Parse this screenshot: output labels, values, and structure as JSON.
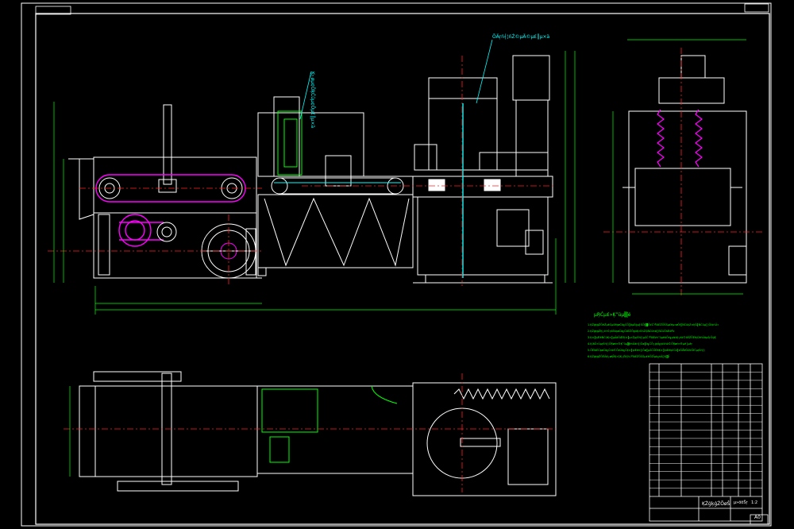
{
  "drawing": {
    "background": "#000000",
    "line_colors": {
      "white": "#ffffff",
      "green": "#00ff00",
      "magenta": "#ff00ff",
      "red": "#ff2020",
      "cyan": "#00ffff",
      "blue": "#3a6cff",
      "yellow": "#ffff00"
    },
    "callouts": {
      "feed_mechanism": "Ķ┐øµ¢ÖķĆüµ¢Öµ£║µ×ä",
      "press_mechanism": "ÕÄŗń┤¦ńŻ©µÄ©µ£║µ×ä"
    },
    "technical_requirements": {
      "title": "µŖĆµ£»Ķ”üµ▒é",
      "items": [
        "1.ĶŻģķģŹÕēŹµēĆµ£ēķøČõ╗ČÕ║öµĖģµ┤ŚÕ╣▓ÕćĆ’╝īõĖŹÕŠŚµ£ēµ»øÕł║ŃĆüķŻ×ĶŠ╣ŃĆüµ░¦Õī¢ńÜ«",
        "2.ĶŻģķģŹĶ┐ćń©ŗõĖŁķøČõ╗ČõĖŹÕģüĶ«ĖńŻĢŃĆüńó░ŃĆüÕłÆõ╝ż",
        "3.Ķ×║ķÆēŃĆüĶ×║µĀōÕÆīĶ×║µ»ŹµŗĖń┤¦µŚČ’╝īõĖźń”üµēōÕć╗µł¢õĮ┐ńö©õĖŹÕÉłķĆéńÜäµŚŗÕģĘ",
        "4.Ķ¦äÕ«ÜµŗĖń┤¦ÕŖøń¤®Ķ”üµ▒éńÜäń┤¦Õø║õ╗ČÕ┐ģķĪ╗ķććńö©ÕŖøń¤®µē│µēŗ",
        "5.ÕÉīõĖĆķøČõ╗Čńö©ÕżÜõ╗ČĶ×║ķÆēń┤¦Õø║µŚČÕÉäĶ×║ķÆēķ£Ćõ║żÕÅēÕØćÕīĆµŗĖń┤¦",
        "6.ĶŻģķģŹÕÉÄĶ┐øĶĪīĶ»ĢĶ┐ÉĶĮ¼’╝īõĖŹÕŠŚµ£ēÕŹĪµŁ╗ńÄ░Ķ▒Ī"
      ]
    },
    "title_block": {
      "drawing_name": "ĶŻģķģŹÕøŠ",
      "scale_label": "µ»öõŠŗ",
      "scale": "1:2",
      "sheet": "A0"
    },
    "parts_list_rows": 16
  }
}
